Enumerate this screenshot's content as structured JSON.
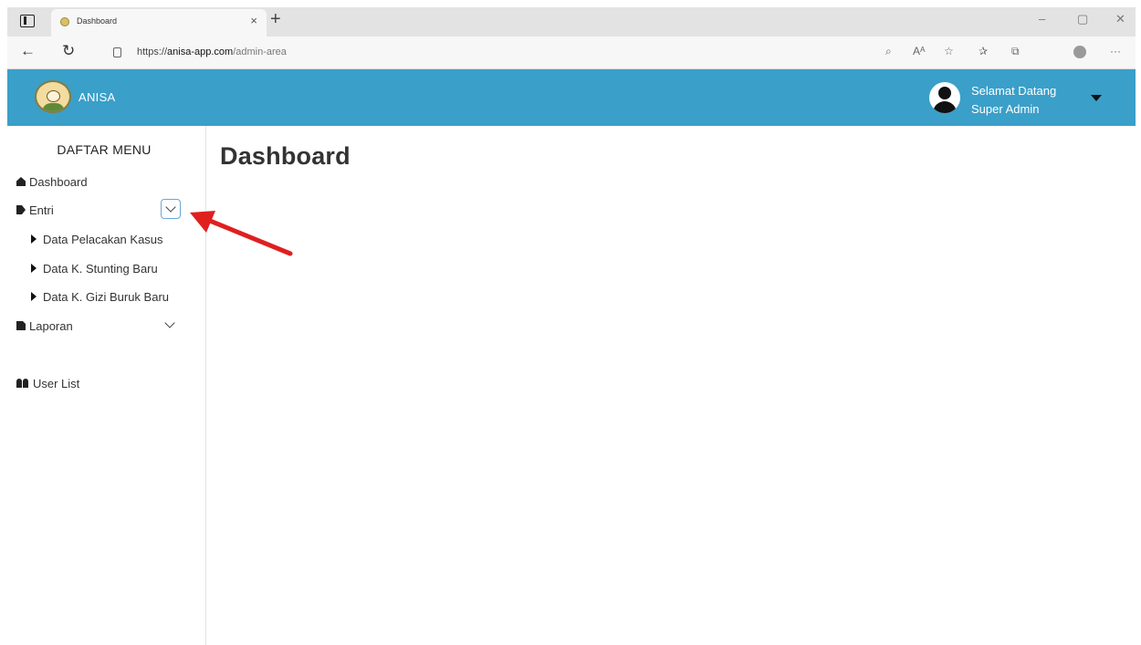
{
  "browser": {
    "tab_title": "Dashboard",
    "tab_close": "×",
    "new_tab": "+",
    "url_prefix": "https://",
    "url_host": "anisa-app.com",
    "url_path": "/admin-area",
    "window_controls": {
      "minimize": "–",
      "restore": "▢",
      "close": "✕"
    },
    "nav": {
      "back": "←",
      "refresh": "↻"
    },
    "toolbar_icons": [
      "search-icon",
      "read-aloud-icon",
      "add-favorite-icon",
      "favorites-icon",
      "collections-icon",
      "profile-icon",
      "more-icon"
    ],
    "toolbar_glyphs": {
      "search": "⌕",
      "read_aloud": "Aᴬ",
      "add_favorite": "☆",
      "favorites": "✰",
      "collections": "⧉",
      "more": "···"
    }
  },
  "header": {
    "brand": "ANISA",
    "greeting_line1": "Selamat Datang",
    "greeting_line2": "Super Admin",
    "accent_color": "#3a9fc9"
  },
  "sidebar": {
    "title": "DAFTAR MENU",
    "items": [
      {
        "label": "Dashboard",
        "icon": "home-icon"
      },
      {
        "label": "Entri",
        "icon": "tag-icon",
        "expanded": true,
        "children": [
          {
            "label": "Data Pelacakan Kasus"
          },
          {
            "label": "Data K. Stunting Baru"
          },
          {
            "label": "Data K. Gizi Buruk Baru"
          }
        ]
      },
      {
        "label": "Laporan",
        "icon": "file-icon",
        "expanded": false
      },
      {
        "label": "User List",
        "icon": "users-icon"
      }
    ]
  },
  "main": {
    "title": "Dashboard"
  },
  "annotation": {
    "color": "#e01f1f",
    "points_to": "entri-toggle"
  }
}
